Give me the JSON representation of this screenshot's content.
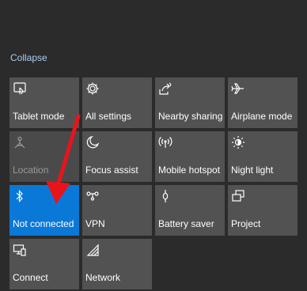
{
  "collapse_label": "Collapse",
  "colors": {
    "background": "#2b2b2b",
    "tile": "#525252",
    "tile_active": "#0a78d7",
    "tile_disabled": "#4a4a4a",
    "link": "#a9cdee",
    "annotation_arrow": "#e8141b"
  },
  "tiles": [
    {
      "label": "Tablet mode",
      "icon": "tablet-mode-icon",
      "active": false,
      "disabled": false
    },
    {
      "label": "All settings",
      "icon": "gear-icon",
      "active": false,
      "disabled": false
    },
    {
      "label": "Nearby sharing",
      "icon": "nearby-sharing-icon",
      "active": false,
      "disabled": false
    },
    {
      "label": "Airplane mode",
      "icon": "airplane-icon",
      "active": false,
      "disabled": false
    },
    {
      "label": "Location",
      "icon": "location-icon",
      "active": false,
      "disabled": true
    },
    {
      "label": "Focus assist",
      "icon": "moon-icon",
      "active": false,
      "disabled": false
    },
    {
      "label": "Mobile hotspot",
      "icon": "hotspot-icon",
      "active": false,
      "disabled": false
    },
    {
      "label": "Night light",
      "icon": "brightness-icon",
      "active": false,
      "disabled": false
    },
    {
      "label": "Not connected",
      "icon": "bluetooth-icon",
      "active": true,
      "disabled": false
    },
    {
      "label": "VPN",
      "icon": "vpn-icon",
      "active": false,
      "disabled": false
    },
    {
      "label": "Battery saver",
      "icon": "battery-saver-icon",
      "active": false,
      "disabled": false
    },
    {
      "label": "Project",
      "icon": "project-icon",
      "active": false,
      "disabled": false
    },
    {
      "label": "Connect",
      "icon": "connect-icon",
      "active": false,
      "disabled": false
    },
    {
      "label": "Network",
      "icon": "network-icon",
      "active": false,
      "disabled": false
    }
  ]
}
